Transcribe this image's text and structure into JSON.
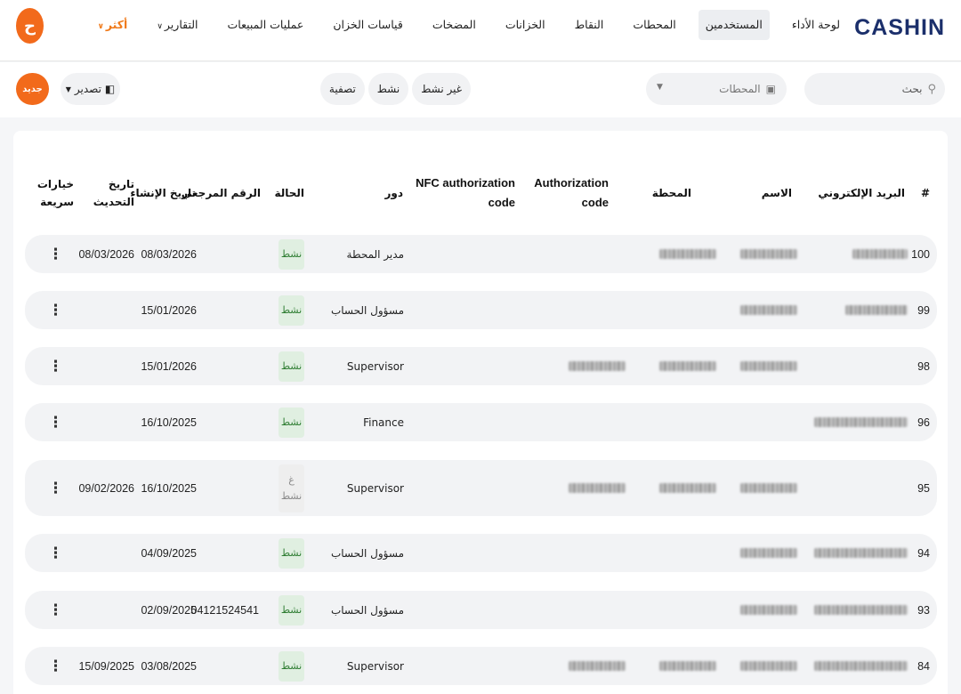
{
  "brand": {
    "logo": "CASHIN",
    "accent": "#f26a1b",
    "logo_color": "#1b2f6b"
  },
  "nav": {
    "items": [
      {
        "label": "لوحة الأداء",
        "active": false
      },
      {
        "label": "المستخدمين",
        "active": true
      },
      {
        "label": "المحطات",
        "active": false
      },
      {
        "label": "النقاط",
        "active": false
      },
      {
        "label": "الخزانات",
        "active": false
      },
      {
        "label": "المضخات",
        "active": false
      },
      {
        "label": "قياسات الخزان",
        "active": false
      },
      {
        "label": "عمليات المبيعات",
        "active": false
      },
      {
        "label": "التقارير",
        "active": false
      },
      {
        "label": "أكثر",
        "active": false
      }
    ],
    "avatar_initial": "ح"
  },
  "toolbar": {
    "search_placeholder": "بحث",
    "station_placeholder": "المحطات",
    "filters": [
      "غير نشط",
      "نشط",
      "تصفية"
    ],
    "export_label": "تصدير",
    "new_label": "جديد"
  },
  "table": {
    "headers": {
      "index": "#",
      "email": "البريد الإلكتروني",
      "name": "الاسم",
      "station": "المحطة",
      "auth_code_1": "Authorization",
      "auth_code_2": "code",
      "nfc_code_1": "NFC authorization",
      "nfc_code_2": "code",
      "role": "دور",
      "status": "الحالة",
      "ref": "الرقم المرجعي",
      "created": "تاريخ الإنشاء",
      "updated_1": "تاريخ",
      "updated_2": "التحديث",
      "actions_1": "خيارات",
      "actions_2": "سريعة"
    },
    "rows": [
      {
        "id": "100",
        "role": "مدير المحطة",
        "status": "نشط",
        "status_inactive": false,
        "ref": "",
        "created": "08/03/2026",
        "updated": "08/03/2026"
      },
      {
        "id": "99",
        "role": "مسؤول الحساب",
        "status": "نشط",
        "status_inactive": false,
        "ref": "",
        "created": "15/01/2026",
        "updated": ""
      },
      {
        "id": "98",
        "role": "Supervisor",
        "status": "نشط",
        "status_inactive": false,
        "ref": "",
        "created": "15/01/2026",
        "updated": ""
      },
      {
        "id": "96",
        "role": "Finance",
        "status": "نشط",
        "status_inactive": false,
        "ref": "",
        "created": "16/10/2025",
        "updated": ""
      },
      {
        "id": "95",
        "role": "Supervisor",
        "status": "غ",
        "status_2": "نشط",
        "status_inactive": true,
        "ref": "",
        "created": "16/10/2025",
        "updated": "09/02/2026"
      },
      {
        "id": "94",
        "role": "مسؤول الحساب",
        "status": "نشط",
        "status_inactive": false,
        "ref": "",
        "created": "04/09/2025",
        "updated": ""
      },
      {
        "id": "93",
        "role": "مسؤول الحساب",
        "status": "نشط",
        "status_inactive": false,
        "ref": "04121524541",
        "created": "02/09/2025",
        "updated": ""
      },
      {
        "id": "84",
        "role": "Supervisor",
        "status": "نشط",
        "status_inactive": false,
        "ref": "",
        "created": "03/08/2025",
        "updated": "15/09/2025"
      }
    ]
  }
}
